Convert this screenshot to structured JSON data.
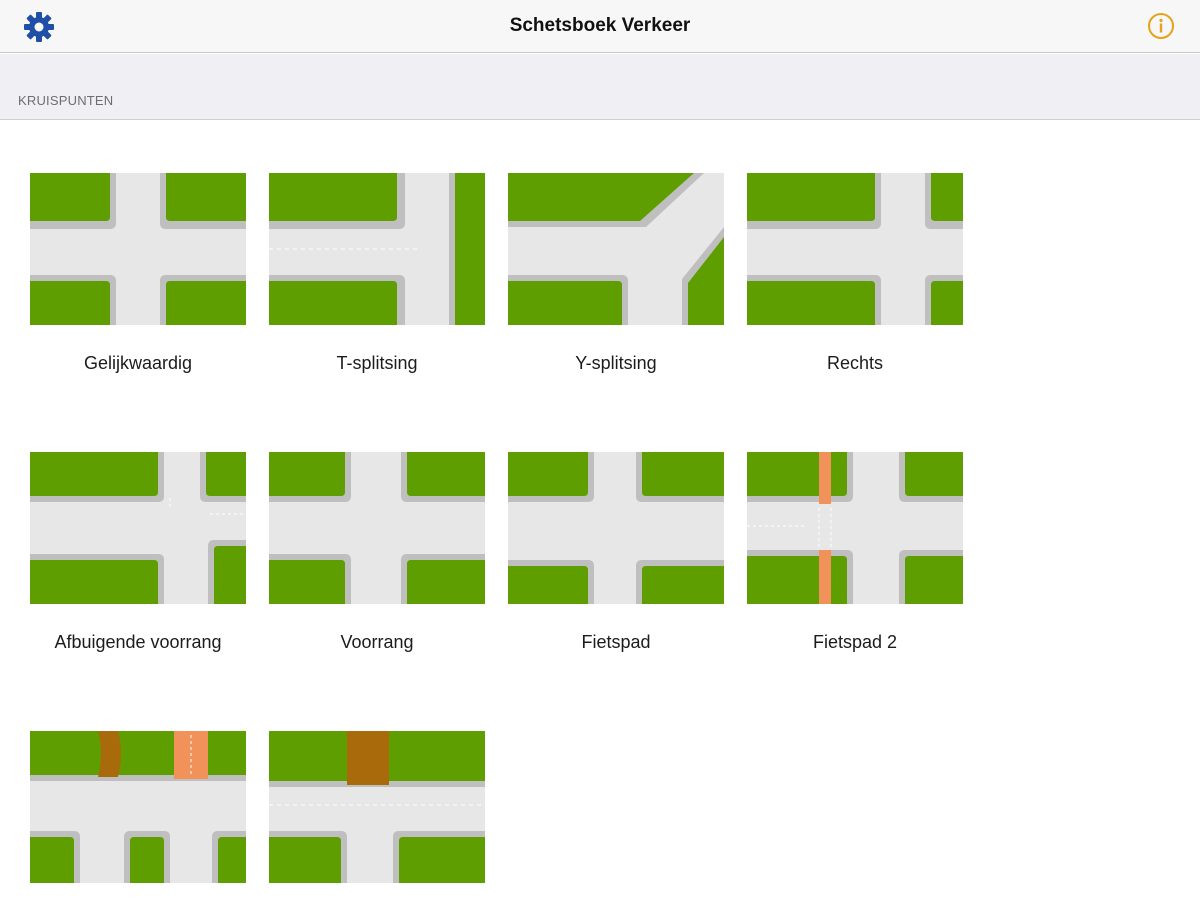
{
  "navbar": {
    "title": "Schetsboek Verkeer",
    "left_icon": "gear-icon",
    "right_icon": "info-icon",
    "accent_color": "#1f4fa6",
    "info_color": "#e8a21a"
  },
  "section": {
    "title": "KRUISPUNTEN"
  },
  "colors": {
    "grass": "#5e9e00",
    "curb": "#bfbfbf",
    "road": "#e7e7e7",
    "bike_path": "#f0925a",
    "dirt_path": "#a96a0c"
  },
  "intersections": [
    {
      "label": "Gelijkwaardig"
    },
    {
      "label": "T-splitsing"
    },
    {
      "label": "Y-splitsing"
    },
    {
      "label": "Rechts"
    },
    {
      "label": "Afbuigende voorrang"
    },
    {
      "label": "Voorrang"
    },
    {
      "label": "Fietspad"
    },
    {
      "label": "Fietspad 2"
    },
    {
      "label": ""
    },
    {
      "label": ""
    }
  ]
}
